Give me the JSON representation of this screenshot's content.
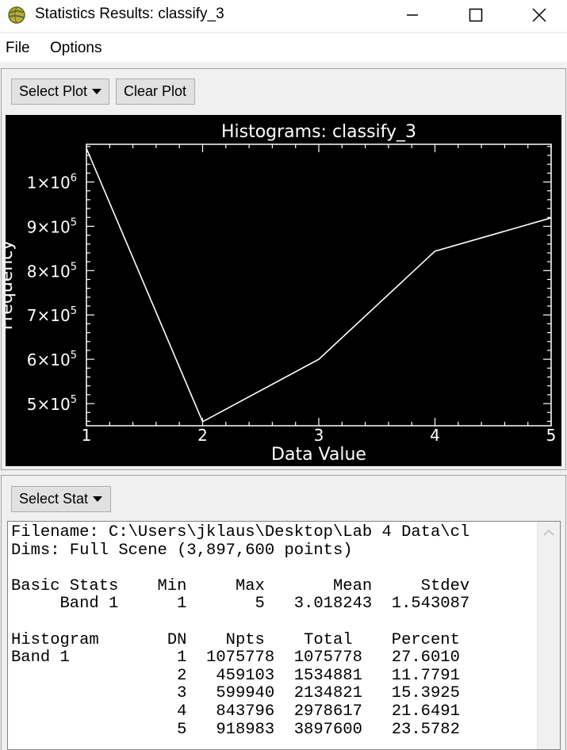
{
  "window": {
    "title": "Statistics Results: classify_3",
    "icon": "globe-app-icon",
    "controls": [
      "minimize-icon",
      "maximize-icon",
      "close-icon"
    ]
  },
  "menu": {
    "file": "File",
    "options": "Options"
  },
  "toolbar": {
    "select_plot": "Select Plot",
    "clear_plot": "Clear Plot",
    "select_stat": "Select Stat"
  },
  "chart_data": {
    "type": "line",
    "title": "Histograms: classify_3",
    "xlabel": "Data Value",
    "ylabel": "Frequency",
    "x": [
      1,
      2,
      3,
      4,
      5
    ],
    "values": [
      1075778,
      459103,
      599940,
      843796,
      918983
    ],
    "xlim": [
      1,
      5
    ],
    "ylim": [
      450000,
      1085000
    ],
    "x_ticks": [
      "1",
      "2",
      "3",
      "4",
      "5"
    ],
    "y_ticks": [
      {
        "value": 500000,
        "mant": "5×10",
        "exp": "5"
      },
      {
        "value": 600000,
        "mant": "6×10",
        "exp": "5"
      },
      {
        "value": 700000,
        "mant": "7×10",
        "exp": "5"
      },
      {
        "value": 800000,
        "mant": "8×10",
        "exp": "5"
      },
      {
        "value": 900000,
        "mant": "9×10",
        "exp": "5"
      },
      {
        "value": 1000000,
        "mant": "1×10",
        "exp": "6"
      }
    ],
    "background": "#000000",
    "foreground": "#ffffff"
  },
  "stats": {
    "text": "Filename: C:\\Users\\jklaus\\Desktop\\Lab 4 Data\\cl\nDims: Full Scene (3,897,600 points)\n\nBasic Stats    Min     Max       Mean     Stdev\n     Band 1      1       5   3.018243  1.543087\n\nHistogram       DN    Npts    Total    Percent\nBand 1           1  1075778  1075778   27.6010\n                 2   459103  1534881   11.7791\n                 3   599940  2134821   15.3925\n                 4   843796  2978617   21.6491\n                 5   918983  3897600   23.5782"
  }
}
